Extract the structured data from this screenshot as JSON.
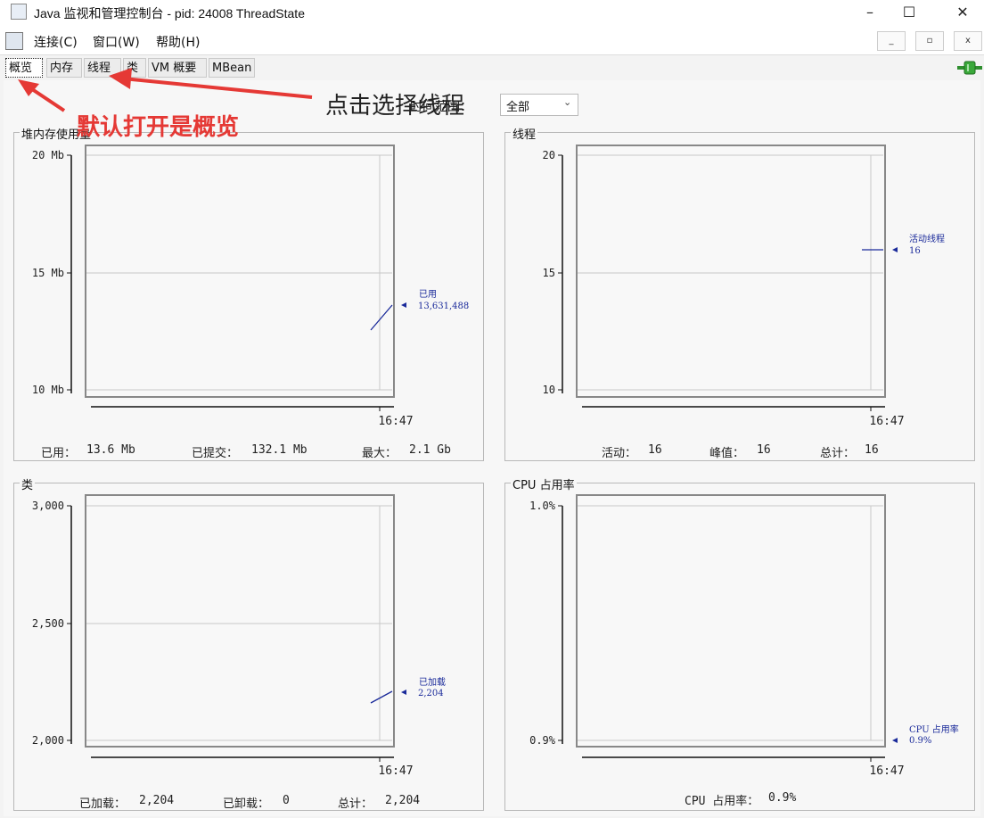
{
  "window": {
    "title": "Java 监视和管理控制台 - pid: 24008 ThreadState",
    "controls": {
      "minimize": "–",
      "maximize": "☐",
      "close": "✕"
    }
  },
  "menu": {
    "items": [
      "连接(C)",
      "窗口(W)",
      "帮助(H)"
    ],
    "mdi": {
      "minimize": "_",
      "restore": "▫",
      "close": "x"
    }
  },
  "tabs": [
    {
      "label": "概览",
      "active": true
    },
    {
      "label": "内存",
      "active": false
    },
    {
      "label": "线程",
      "active": false
    },
    {
      "label": "类",
      "active": false
    },
    {
      "label": "VM 概要",
      "active": false
    },
    {
      "label": "MBean",
      "active": false
    }
  ],
  "time_range": {
    "label": "时间范围：",
    "value": "全部"
  },
  "annotations": {
    "red": "默认打开是概览",
    "black": "点击选择线程",
    "arrow_color": "#e53935"
  },
  "panels": {
    "heap": {
      "title": "堆内存使用量",
      "y_ticks": [
        "20 Mb",
        "15 Mb",
        "10 Mb"
      ],
      "x_tick": "16:47",
      "marker_label": "已用",
      "marker_value": "13,631,488",
      "stats": [
        {
          "label": "已用：",
          "value": "13.6  Mb"
        },
        {
          "label": "已提交：",
          "value": "132.1  Mb"
        },
        {
          "label": "最大：",
          "value": "2.1  Gb"
        }
      ]
    },
    "threads": {
      "title": "线程",
      "y_ticks": [
        "20",
        "15",
        "10"
      ],
      "x_tick": "16:47",
      "marker_label": "活动线程",
      "marker_value": "16",
      "stats": [
        {
          "label": "活动：",
          "value": "16"
        },
        {
          "label": "峰值：",
          "value": "16"
        },
        {
          "label": "总计：",
          "value": "16"
        }
      ]
    },
    "classes": {
      "title": "类",
      "y_ticks": [
        "3,000",
        "2,500",
        "2,000"
      ],
      "x_tick": "16:47",
      "marker_label": "已加载",
      "marker_value": "2,204",
      "stats": [
        {
          "label": "已加载：",
          "value": "2,204"
        },
        {
          "label": "已卸载：",
          "value": "0"
        },
        {
          "label": "总计：",
          "value": "2,204"
        }
      ]
    },
    "cpu": {
      "title": "CPU 占用率",
      "y_ticks": [
        "1.0%",
        "0.9%"
      ],
      "x_tick": "16:47",
      "marker_label": "CPU 占用率",
      "marker_value": "0.9%",
      "stats": [
        {
          "label": "CPU 占用率：",
          "value": "0.9%"
        }
      ]
    }
  },
  "chart_data": [
    {
      "type": "line",
      "title": "堆内存使用量",
      "ylabel": "Mb",
      "ylim": [
        10,
        20
      ],
      "x": [
        "16:47"
      ],
      "series": [
        {
          "name": "已用",
          "values": [
            13.6
          ]
        }
      ]
    },
    {
      "type": "line",
      "title": "线程",
      "ylim": [
        10,
        20
      ],
      "x": [
        "16:47"
      ],
      "series": [
        {
          "name": "活动线程",
          "values": [
            16
          ]
        }
      ]
    },
    {
      "type": "line",
      "title": "类",
      "ylim": [
        2000,
        3000
      ],
      "x": [
        "16:47"
      ],
      "series": [
        {
          "name": "已加载",
          "values": [
            2204
          ]
        }
      ]
    },
    {
      "type": "line",
      "title": "CPU 占用率",
      "ylim": [
        0.9,
        1.0
      ],
      "x": [
        "16:47"
      ],
      "series": [
        {
          "name": "CPU 占用率",
          "values": [
            0.9
          ]
        }
      ]
    }
  ],
  "colors": {
    "series_line": "#1a2a9a",
    "grid": "#c8c8c8",
    "annotation_red": "#e53935"
  }
}
